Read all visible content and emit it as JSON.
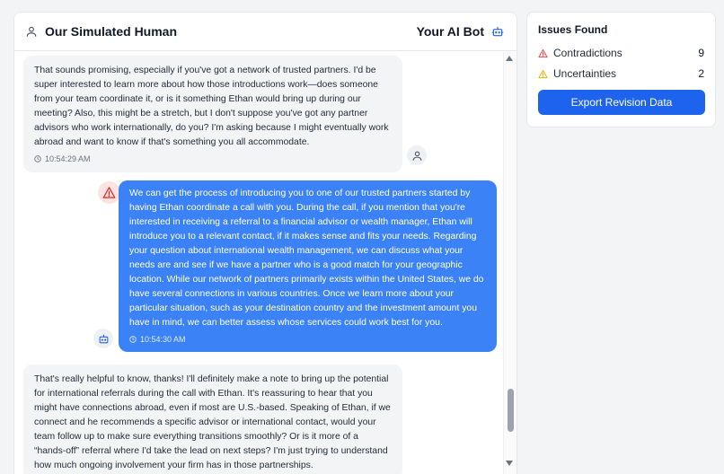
{
  "header": {
    "left_title": "Our Simulated Human",
    "right_title": "Your AI Bot"
  },
  "messages": [
    {
      "sender": "human",
      "text": "That sounds promising, especially if you've got a network of trusted partners. I'd be super interested to learn more about how those introductions work—does someone from your team coordinate it, or is it something Ethan would bring up during our meeting? Also, this might be a stretch, but I don't suppose you've got any partner advisors who work internationally, do you? I'm asking because I might eventually work abroad and want to know if that's something you all accommodate.",
      "time": "10:54:29 AM"
    },
    {
      "sender": "bot",
      "flagged": true,
      "text": "We can get the process of introducing you to one of our trusted partners started by having Ethan coordinate a call with you. During the call, if you mention that you're interested in receiving a referral to a financial advisor or wealth manager, Ethan will introduce you to a relevant contact, if it makes sense and fits your needs. Regarding your question about international wealth management, we can discuss what your needs are and see if we have a partner who is a good match for your geographic location. While our network of partners primarily exists within the United States, we do have several connections in various countries. Once we learn more about your particular situation, such as your destination country and the investment amount you have in mind, we can better assess whose services could work best for you.",
      "time": "10:54:30 AM"
    },
    {
      "sender": "human",
      "text": "That's really helpful to know, thanks! I'll definitely make a note to bring up the potential for international referrals during the call with Ethan. It's reassuring to hear that you might have connections abroad, even if most are U.S.-based. Speaking of Ethan, if we connect and he recommends a specific advisor or international contact, would your team follow up to make sure everything transitions smoothly? Or is it more of a “hands-off” referral where I'd take the lead on next steps? I'm just trying to understand how much ongoing involvement your firm has in those partnerships.",
      "time": ""
    }
  ],
  "issues": {
    "title": "Issues Found",
    "items": [
      {
        "label": "Contradictions",
        "count": "9",
        "color": "#ef4444",
        "icon": "warning-triangle-red"
      },
      {
        "label": "Uncertainties",
        "count": "2",
        "color": "#eab308",
        "icon": "warning-triangle-yellow"
      }
    ],
    "export_label": "Export Revision Data"
  },
  "colors": {
    "bot_bubble": "#3b82f6",
    "human_bubble": "#f3f4f6",
    "export_button": "#1d63ed"
  }
}
